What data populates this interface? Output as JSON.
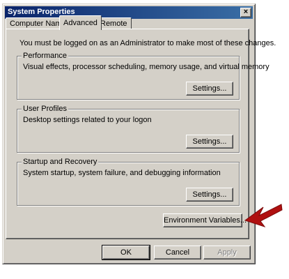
{
  "window": {
    "title": "System Properties",
    "close_glyph": "×"
  },
  "tabs": [
    {
      "label": "Computer Name",
      "active": false
    },
    {
      "label": "Advanced",
      "active": true
    },
    {
      "label": "Remote",
      "active": false
    }
  ],
  "advanced": {
    "admin_note": "You must be logged on as an Administrator to make most of these changes.",
    "performance": {
      "title": "Performance",
      "description": "Visual effects, processor scheduling, memory usage, and virtual memory",
      "button": "Settings..."
    },
    "user_profiles": {
      "title": "User Profiles",
      "description": "Desktop settings related to your logon",
      "button": "Settings..."
    },
    "startup_recovery": {
      "title": "Startup and Recovery",
      "description": "System startup, system failure, and debugging information",
      "button": "Settings..."
    },
    "env_button": "Environment Variables..."
  },
  "footer": {
    "ok": "OK",
    "cancel": "Cancel",
    "apply": "Apply"
  },
  "colors": {
    "dialog_face": "#d4d0c8",
    "titlebar_start": "#0a246a",
    "titlebar_end": "#3a6ea5",
    "annotation_arrow": "#b01010"
  },
  "icons": {
    "annotation": "red-arrow-icon"
  }
}
